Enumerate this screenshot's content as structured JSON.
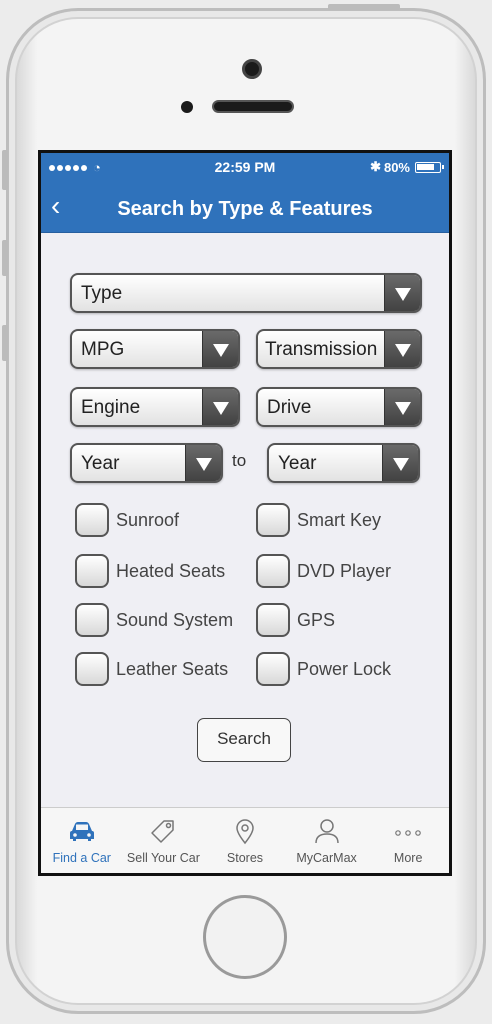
{
  "status_bar": {
    "time": "22:59 PM",
    "battery_percent": "80%",
    "signal_icon": "signal-dots-icon",
    "wifi_icon": "wifi-icon",
    "bluetooth_icon": "bluetooth-icon"
  },
  "nav": {
    "title": "Search by Type & Features",
    "back_icon": "chevron-left-icon"
  },
  "filters": {
    "type": "Type",
    "mpg": "MPG",
    "transmission": "Transmission",
    "engine": "Engine",
    "drive": "Drive",
    "year_from": "Year",
    "year_to": "Year",
    "to_label": "to"
  },
  "features": [
    {
      "label": "Sunroof",
      "checked": false
    },
    {
      "label": "Smart Key",
      "checked": false
    },
    {
      "label": "Heated Seats",
      "checked": false
    },
    {
      "label": "DVD Player",
      "checked": false
    },
    {
      "label": "Sound System",
      "checked": false
    },
    {
      "label": "GPS",
      "checked": false
    },
    {
      "label": "Leather Seats",
      "checked": false
    },
    {
      "label": "Power Lock",
      "checked": false
    }
  ],
  "search_button": "Search",
  "tabs": [
    {
      "label": "Find a Car",
      "icon": "car-icon",
      "active": true
    },
    {
      "label": "Sell Your Car",
      "icon": "price-tag-icon",
      "active": false
    },
    {
      "label": "Stores",
      "icon": "location-pin-icon",
      "active": false
    },
    {
      "label": "MyCarMax",
      "icon": "user-icon",
      "active": false
    },
    {
      "label": "More",
      "icon": "more-dots-icon",
      "active": false
    }
  ],
  "colors": {
    "accent": "#2f72bb",
    "background": "#efeff4",
    "tab_inactive": "#555555"
  }
}
